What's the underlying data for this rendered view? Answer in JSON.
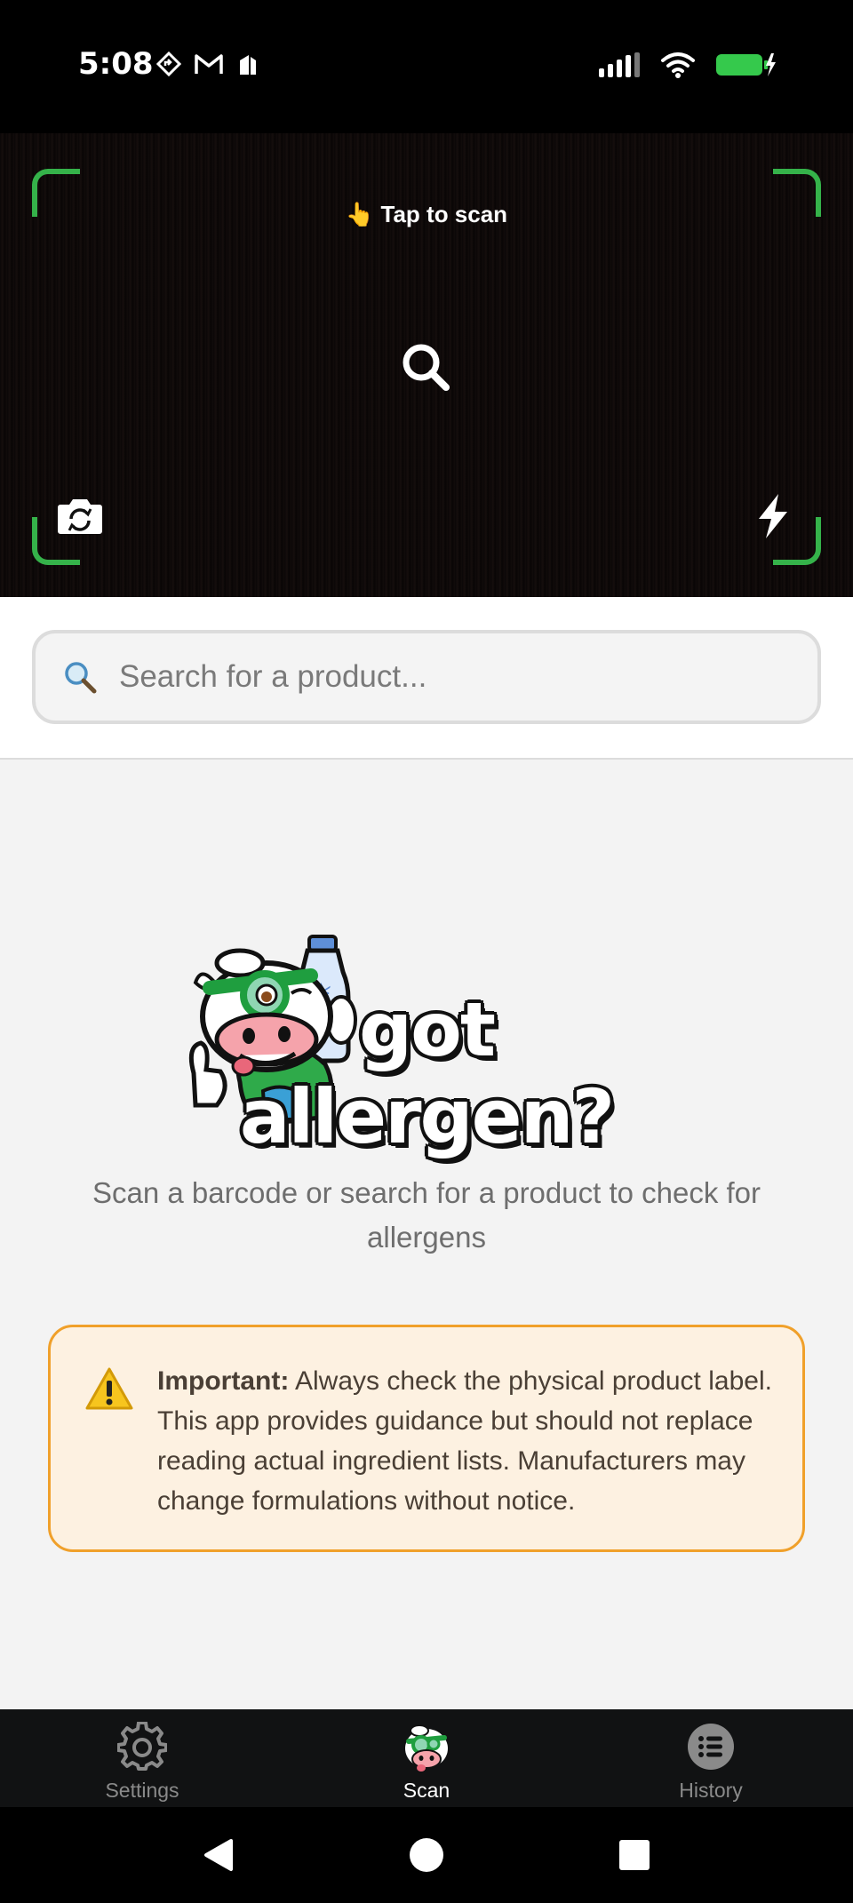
{
  "status_bar": {
    "time": "5:08",
    "left_icons": [
      "location-diamond-icon",
      "gmail-icon",
      "notification-app-icon"
    ],
    "right_icons": [
      "signal-icon",
      "wifi-icon",
      "battery-charging-icon"
    ]
  },
  "camera": {
    "hint": "👆 Tap to scan",
    "corner_color": "#35b24a"
  },
  "search": {
    "icon": "🔍",
    "placeholder": "Search for a product..."
  },
  "main": {
    "logo_text": "got allergen?",
    "tagline": "Scan a barcode or search for a product to check for allergens",
    "warning": {
      "icon": "⚠️",
      "title": "Important:",
      "body": " Always check the physical product label. This app provides guidance but should not replace reading actual ingredient lists. Manufacturers may change formulations without notice."
    }
  },
  "nav": {
    "items": [
      {
        "label": "Settings",
        "icon": "gear-icon"
      },
      {
        "label": "Scan",
        "icon": "cow-mascot-icon"
      },
      {
        "label": "History",
        "icon": "list-icon"
      }
    ],
    "active": "Scan"
  },
  "colors": {
    "accent_green": "#35b24a",
    "warning_border": "#f0a02a",
    "warning_bg": "#fdf1e1"
  }
}
